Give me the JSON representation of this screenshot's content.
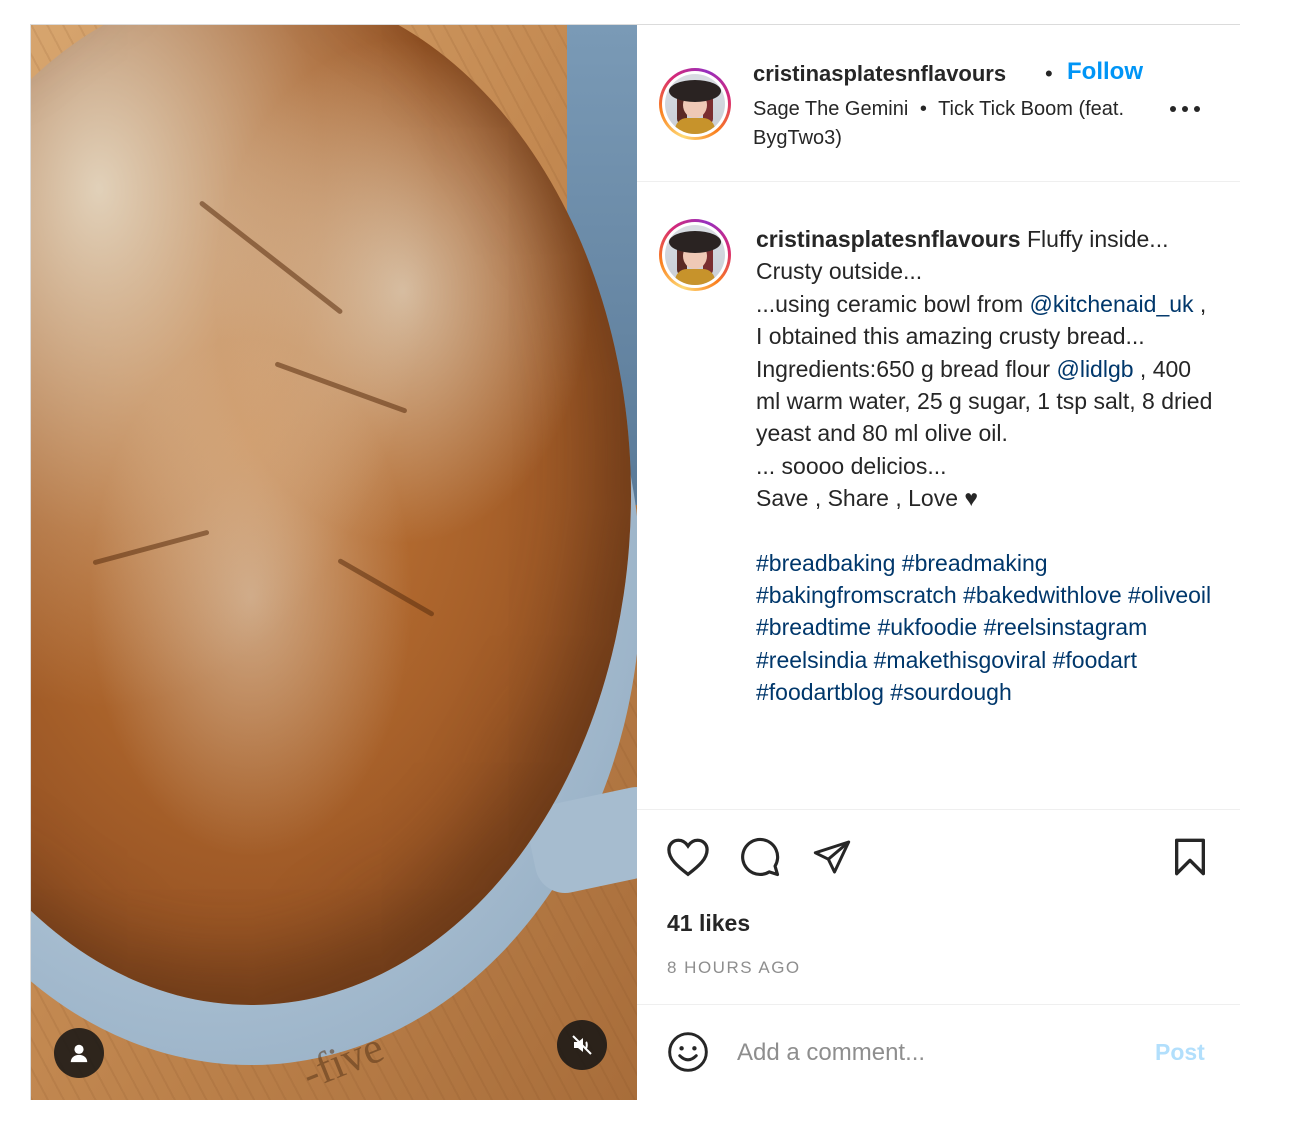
{
  "post": {
    "username": "cristinasplatesnflavours",
    "separator": "•",
    "follow_label": "Follow",
    "audio_artist": "Sage The Gemini",
    "audio_dot": "•",
    "audio_track": "Tick Tick Boom (feat. BygTwo3)",
    "more_icon": "more-horizontal-icon",
    "media_brand_text": "-five"
  },
  "caption": {
    "username": "cristinasplatesnflavours",
    "line1": " Fluffy inside...",
    "line2": "Crusty outside...",
    "line3": "...using ceramic bowl from ",
    "mention1": "@kitchenaid_uk",
    "line4": " , I obtained this amazing crusty bread...",
    "line5": "Ingredients:650 g bread flour ",
    "mention2": "@lidlgb",
    "line6": " , 400 ml warm water, 25 g sugar, 1 tsp salt, 8 dried yeast and 80 ml olive oil.",
    "line7": "... soooo delicios...",
    "line8": "Save , Share , Love ♥",
    "hashtags": "#breadbaking #breadmaking #bakingfromscratch #bakedwithlove #oliveoil #breadtime #ukfoodie #reelsinstagram #reelsindia #makethisgoviral #foodart #foodartblog #sourdough"
  },
  "engagement": {
    "likes": "41 likes",
    "time_ago": "8 HOURS AGO"
  },
  "comment": {
    "placeholder": "Add a comment...",
    "post_label": "Post"
  },
  "colors": {
    "accent_blue": "#0095f6",
    "link_blue": "#00376b",
    "post_disabled": "#b2dffc",
    "muted": "#8e8e8e"
  }
}
